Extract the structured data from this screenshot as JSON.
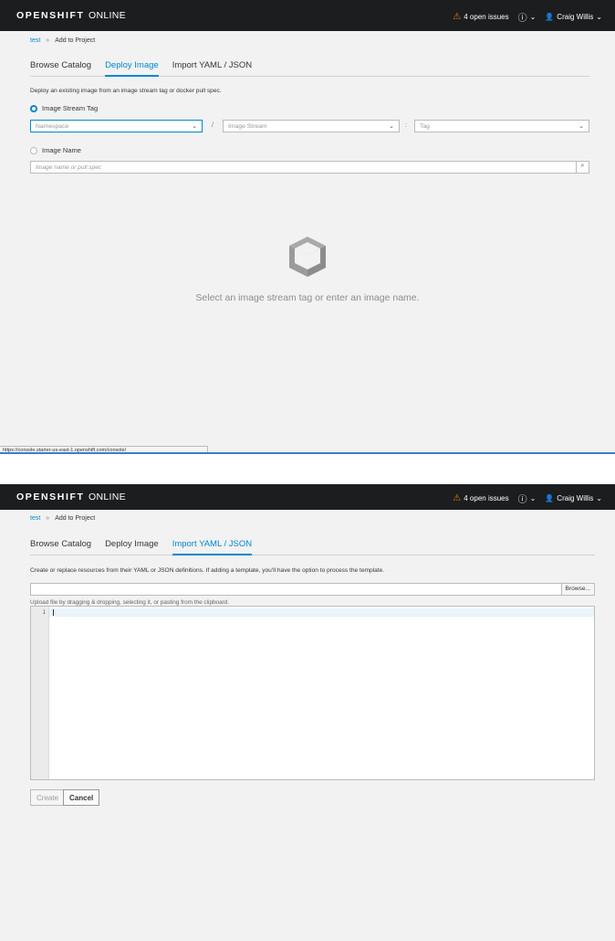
{
  "navbar": {
    "brand_bold": "OPENSHIFT",
    "brand_light": "ONLINE",
    "issues_label": "4 open issues",
    "help_icon": "question-circle-icon",
    "user_name": "Craig Willis",
    "warning_color": "#ec7a08"
  },
  "breadcrumb": {
    "project": "test",
    "separator": "»",
    "current": "Add to Project"
  },
  "tabs": [
    "Browse Catalog",
    "Deploy Image",
    "Import YAML / JSON"
  ],
  "deploy_image": {
    "description": "Deploy an existing image from an image stream tag or docker pull spec.",
    "option_stream_tag": "Image Stream Tag",
    "namespace_placeholder": "Namespace",
    "slash": "/",
    "image_stream_placeholder": "Image Stream",
    "colon": ":",
    "tag_placeholder": "Tag",
    "option_image_name": "Image Name",
    "image_name_placeholder": "Image name or pull spec",
    "empty_state_text": "Select an image stream tag or enter an image name.",
    "status_url": "https://console.starter-us-east-1.openshift.com/console/"
  },
  "import_yaml": {
    "description": "Create or replace resources from their YAML or JSON definitions. If adding a template, you'll have the option to process the template.",
    "browse_label": "Browse...",
    "upload_help": "Upload file by dragging & dropping, selecting it, or pasting from the clipboard.",
    "line_number": "1",
    "create_label": "Create",
    "cancel_label": "Cancel"
  },
  "accent_color": "#0088ce"
}
